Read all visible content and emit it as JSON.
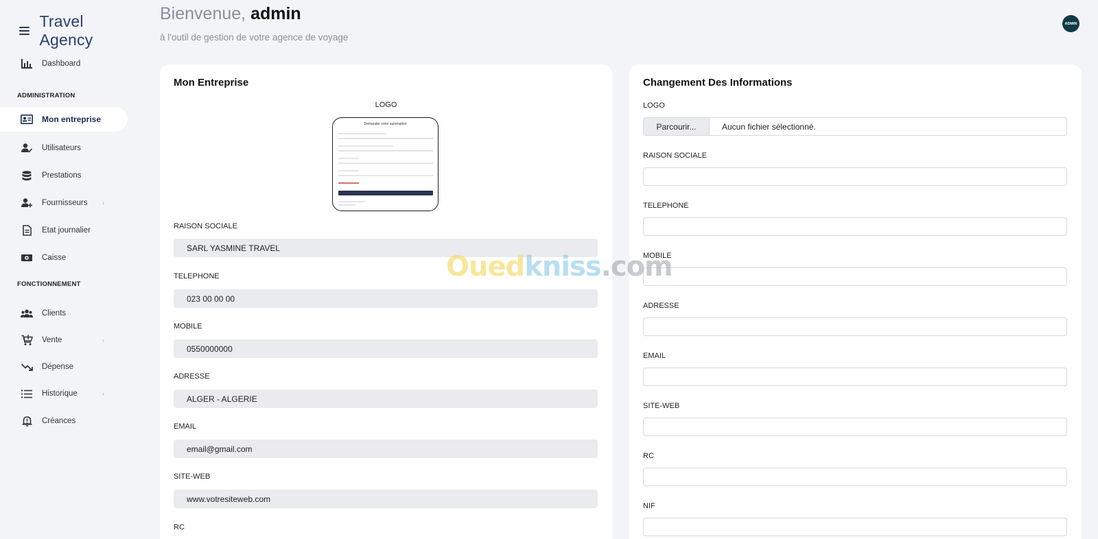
{
  "app": {
    "title": "Travel Agency"
  },
  "header": {
    "welcome_prefix": "Bienvenue,",
    "welcome_user": "admin",
    "subtitle": "à l'outil de gestion de votre agence de voyage",
    "avatar_text": "ADMIN"
  },
  "sidebar": {
    "top_items": [
      {
        "label": "Dashboard",
        "icon": "bar-chart-icon"
      }
    ],
    "sections": [
      {
        "label": "ADMINISTRATION",
        "items": [
          {
            "label": "Mon entreprise",
            "icon": "id-card-icon",
            "active": true
          },
          {
            "label": "Utilisateurs",
            "icon": "user-check-icon"
          },
          {
            "label": "Prestations",
            "icon": "database-icon"
          },
          {
            "label": "Fournisseurs",
            "icon": "user-plus-icon",
            "has_submenu": true
          },
          {
            "label": "Etat journalier",
            "icon": "document-icon"
          },
          {
            "label": "Caisse",
            "icon": "cash-icon"
          }
        ]
      },
      {
        "label": "FONCTIONNEMENT",
        "items": [
          {
            "label": "Clients",
            "icon": "users-icon"
          },
          {
            "label": "Vente",
            "icon": "cart-icon",
            "has_submenu": true
          },
          {
            "label": "Dépense",
            "icon": "trend-down-icon"
          },
          {
            "label": "Historique",
            "icon": "list-icon",
            "has_submenu": true
          },
          {
            "label": "Créances",
            "icon": "alert-bell-icon"
          }
        ]
      }
    ],
    "chevron": "›"
  },
  "left_card": {
    "title": "Mon Entreprise",
    "logo_label": "LOGO",
    "logo_preview_title": "Demander votre automation",
    "fields": [
      {
        "label": "RAISON SOCIALE",
        "value": "SARL YASMINE TRAVEL"
      },
      {
        "label": "TELEPHONE",
        "value": "023 00 00 00"
      },
      {
        "label": "MOBILE",
        "value": "0550000000"
      },
      {
        "label": "ADRESSE",
        "value": "ALGER - ALGERIE"
      },
      {
        "label": "EMAIL",
        "value": "email@gmail.com"
      },
      {
        "label": "SITE-WEB",
        "value": "www.votresiteweb.com"
      },
      {
        "label": "RC",
        "value": ""
      }
    ]
  },
  "right_card": {
    "title": "Changement Des Informations",
    "logo_label": "LOGO",
    "file_button": "Parcourir...",
    "file_status": "Aucun fichier sélectionné.",
    "fields": [
      {
        "label": "RAISON SOCIALE",
        "value": ""
      },
      {
        "label": "TELEPHONE",
        "value": ""
      },
      {
        "label": "MOBILE",
        "value": ""
      },
      {
        "label": "ADRESSE",
        "value": ""
      },
      {
        "label": "EMAIL",
        "value": ""
      },
      {
        "label": "SITE-WEB",
        "value": ""
      },
      {
        "label": "RC",
        "value": ""
      },
      {
        "label": "NIF",
        "value": ""
      }
    ]
  },
  "watermark": {
    "part1": "Oued",
    "part2": "kniss",
    "part3": ".com"
  }
}
